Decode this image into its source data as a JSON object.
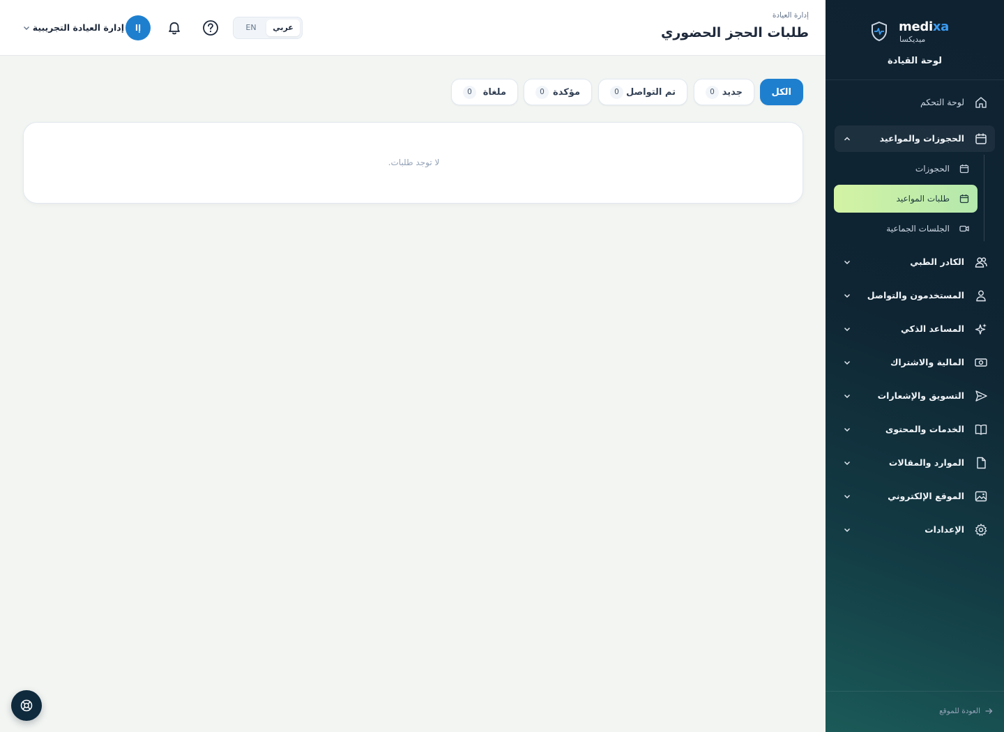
{
  "brand": {
    "name_prefix": "medi",
    "name_accent": "xa",
    "name_ar": "ميديكسا",
    "subtitle": "لوحة القيادة"
  },
  "sidebar": {
    "items": [
      {
        "label": "لوحة التحكم",
        "icon": "home-icon"
      },
      {
        "label": "الحجوزات والمواعيد",
        "icon": "calendar-icon",
        "expanded": true
      },
      {
        "label": "الكادر الطبي",
        "icon": "users-icon"
      },
      {
        "label": "المستخدمون والتواصل",
        "icon": "user-icon"
      },
      {
        "label": "المساعد الذكي",
        "icon": "sparkles-icon"
      },
      {
        "label": "المالية والاشتراك",
        "icon": "money-icon"
      },
      {
        "label": "التسويق والإشعارات",
        "icon": "send-icon"
      },
      {
        "label": "الخدمات والمحتوى",
        "icon": "book-icon"
      },
      {
        "label": "الموارد والمقالات",
        "icon": "file-icon"
      },
      {
        "label": "الموقع الإلكتروني",
        "icon": "image-icon"
      },
      {
        "label": "الإعدادات",
        "icon": "gear-icon"
      }
    ],
    "subitems": [
      {
        "label": "الحجوزات",
        "icon": "calendar-icon"
      },
      {
        "label": "طلبات المواعيد",
        "icon": "calendar-icon",
        "active": true
      },
      {
        "label": "الجلسات الجماعية",
        "icon": "video-icon"
      }
    ],
    "back_link": "العودة للموقع"
  },
  "header": {
    "breadcrumb": "إدارة العيادة",
    "title": "طلبات الحجز الحضوري",
    "lang_ar": "عربي",
    "lang_en": "EN",
    "user_initials": "إا",
    "user_name": "إدارة العيادة التجريبية"
  },
  "filters": [
    {
      "label": "الكل",
      "active": true
    },
    {
      "label": "جديد",
      "count": "0"
    },
    {
      "label": "تم التواصل",
      "count": "0"
    },
    {
      "label": "مؤكدة",
      "count": "0"
    },
    {
      "label": "ملغاة",
      "count": "0"
    }
  ],
  "empty_message": "لا توجد طلبات.",
  "colors": {
    "accent": "#1f7fcf",
    "sidebar_bg": "#0f2231",
    "active_sub_bg": "#d3f3a4"
  }
}
